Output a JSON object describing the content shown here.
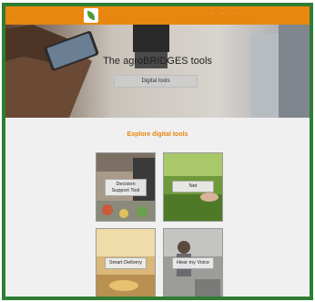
{
  "header": {
    "logo_icon": "agrobridges-logo-icon",
    "nav": [
      "···",
      "····",
      "····"
    ],
    "bar_color": "#e8870f"
  },
  "hero": {
    "title": "The agroBRIDGES tools",
    "button_label": "Digital tools"
  },
  "section": {
    "title": "Explore digital tools",
    "title_color": "#e8870f"
  },
  "tools": [
    {
      "label_line1": "Decision",
      "label_line2": "Support Tool"
    },
    {
      "label": "Net"
    },
    {
      "label": "Smart Delivery"
    },
    {
      "label": "Hear my Voice"
    }
  ],
  "frame_color": "#2f7d32"
}
